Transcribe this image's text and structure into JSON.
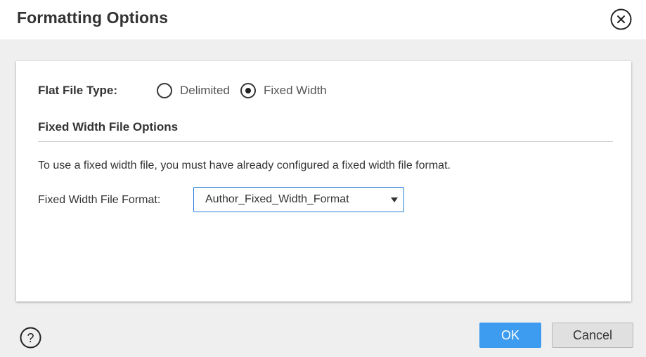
{
  "dialog": {
    "title": "Formatting Options"
  },
  "flat_file_type": {
    "label": "Flat File Type:",
    "options": [
      {
        "label": "Delimited",
        "selected": false
      },
      {
        "label": "Fixed Width",
        "selected": true
      }
    ]
  },
  "fixed_width_section": {
    "title": "Fixed Width File Options",
    "info": "To use a fixed width file, you must have already configured a fixed width file format.",
    "format_label": "Fixed Width File Format:",
    "format_value": "Author_Fixed_Width_Format"
  },
  "footer": {
    "ok_label": "OK",
    "cancel_label": "Cancel"
  },
  "colors": {
    "accent": "#3d9cf0",
    "select_border": "#2a7ed8",
    "background": "#efefef"
  },
  "icons": {
    "close": "close-icon",
    "help": "help-icon",
    "dropdown": "caret-down-icon"
  }
}
